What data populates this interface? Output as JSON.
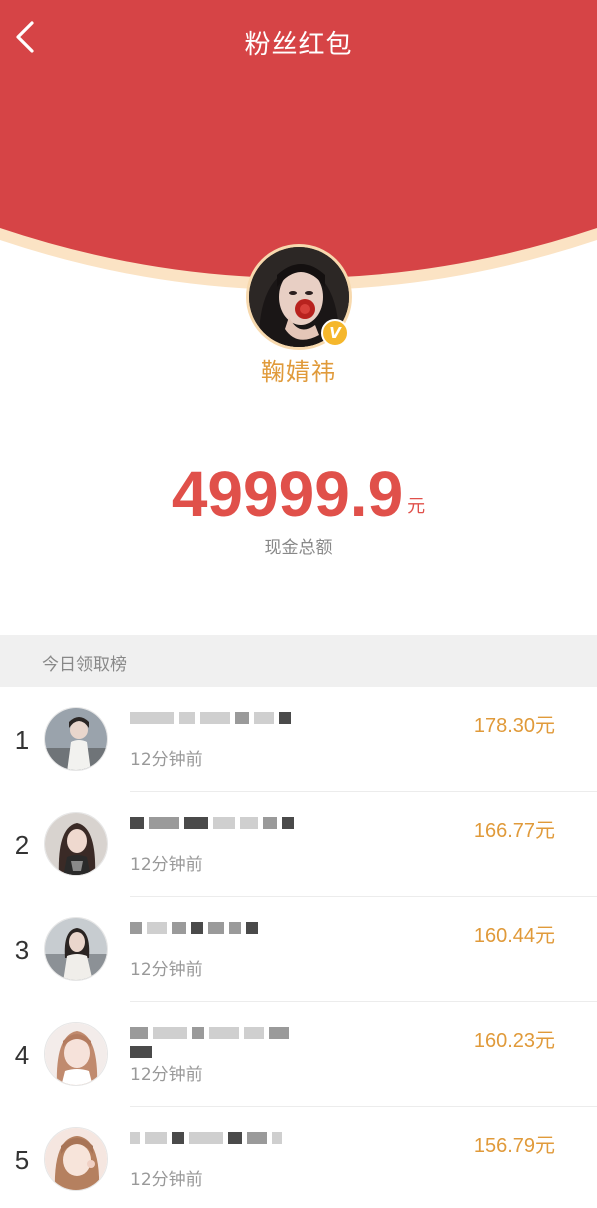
{
  "header": {
    "title": "粉丝红包",
    "back_icon": "chevron-left-icon",
    "bg_color": "#d64446",
    "arc_color": "#fbe3c4"
  },
  "profile": {
    "name": "鞠婧祎",
    "verified_badge": "V",
    "badge_color": "#f5b72c"
  },
  "cash": {
    "amount": "49999.9",
    "unit": "元",
    "label": "现金总额",
    "color": "#e0504a"
  },
  "leaderboard": {
    "title": "今日领取榜",
    "amount_color": "#e09a3a",
    "rows": [
      {
        "rank": "1",
        "time": "12分钟前",
        "amount": "178.30元"
      },
      {
        "rank": "2",
        "time": "12分钟前",
        "amount": "166.77元"
      },
      {
        "rank": "3",
        "time": "12分钟前",
        "amount": "160.44元"
      },
      {
        "rank": "4",
        "time": "12分钟前",
        "amount": "160.23元"
      },
      {
        "rank": "5",
        "time": "12分钟前",
        "amount": "156.79元"
      }
    ]
  }
}
